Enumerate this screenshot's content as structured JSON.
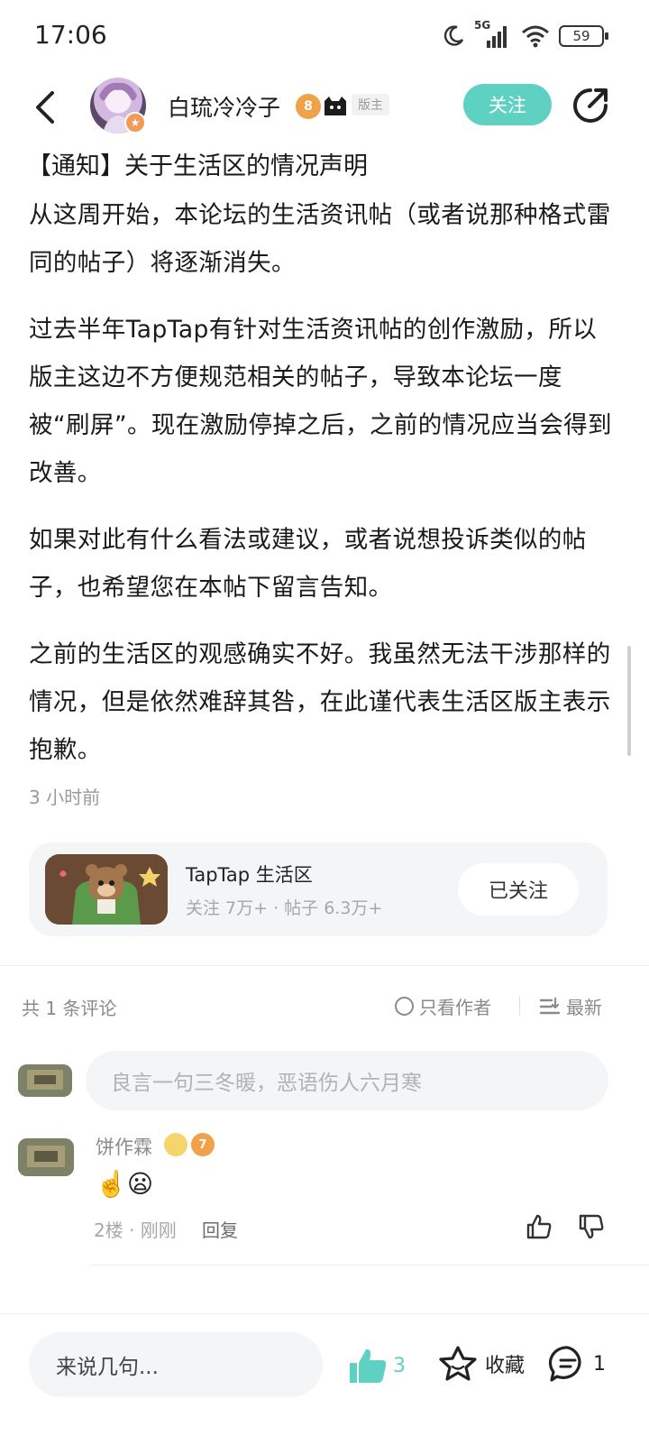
{
  "status_bar": {
    "time": "17:06",
    "network": "5G",
    "battery": "59"
  },
  "header": {
    "author_name": "白琉冷冷子",
    "level": "8",
    "moderator_badge": "版主",
    "follow_label": "关注"
  },
  "post": {
    "title": "【通知】关于生活区的情况声明",
    "paragraphs": [
      "从这周开始，本论坛的生活资讯帖（或者说那种格式雷同的帖子）将逐渐消失。",
      "过去半年TapTap有针对生活资讯帖的创作激励，所以版主这边不方便规范相关的帖子，导致本论坛一度被“刷屏”。现在激励停掉之后，之前的情况应当会得到改善。",
      "如果对此有什么看法或建议，或者说想投诉类似的帖子，也希望您在本帖下留言告知。",
      "之前的生活区的观感确实不好。我虽然无法干涉那样的情况，但是依然难辞其咎，在此谨代表生活区版主表示抱歉。"
    ],
    "time": "3 小时前"
  },
  "forum_card": {
    "name": "TapTap 生活区",
    "stats": "关注 7万+ · 帖子 6.3万+",
    "follow_label": "已关注"
  },
  "comments_header": {
    "count_label": "共 1 条评论",
    "only_author_label": "只看作者",
    "sort_label": "最新"
  },
  "comment_input": {
    "placeholder": "良言一句三冬暖，恶语伤人六月寒"
  },
  "comments": [
    {
      "author": "饼作霖",
      "level": "7",
      "content": "☝️😦",
      "meta": "2楼 · 刚刚",
      "reply_label": "回复"
    }
  ],
  "bottom_bar": {
    "input_placeholder": "来说几句...",
    "like_count": "3",
    "favorite_label": "收藏",
    "comment_count": "1"
  },
  "colors": {
    "accent": "#5fd1c3",
    "text_primary": "#1a1a1a",
    "text_secondary": "#8a8a8a"
  }
}
